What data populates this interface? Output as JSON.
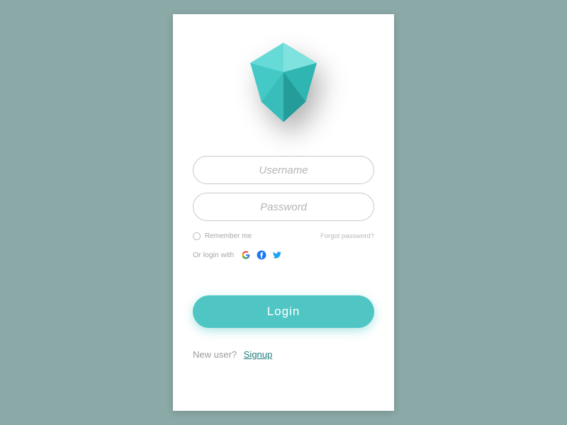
{
  "form": {
    "username_placeholder": "Username",
    "password_placeholder": "Password",
    "remember_label": "Remember me",
    "forgot_label": "Forgot password?",
    "social_label": "Or login with",
    "login_label": "Login"
  },
  "footer": {
    "new_user_label": "New user?",
    "signup_label": "Signup"
  },
  "icons": {
    "google_name": "google-icon",
    "facebook_name": "facebook-icon",
    "twitter_name": "twitter-icon"
  },
  "colors": {
    "accent": "#4fc6c4",
    "background": "#8aa9a7"
  }
}
